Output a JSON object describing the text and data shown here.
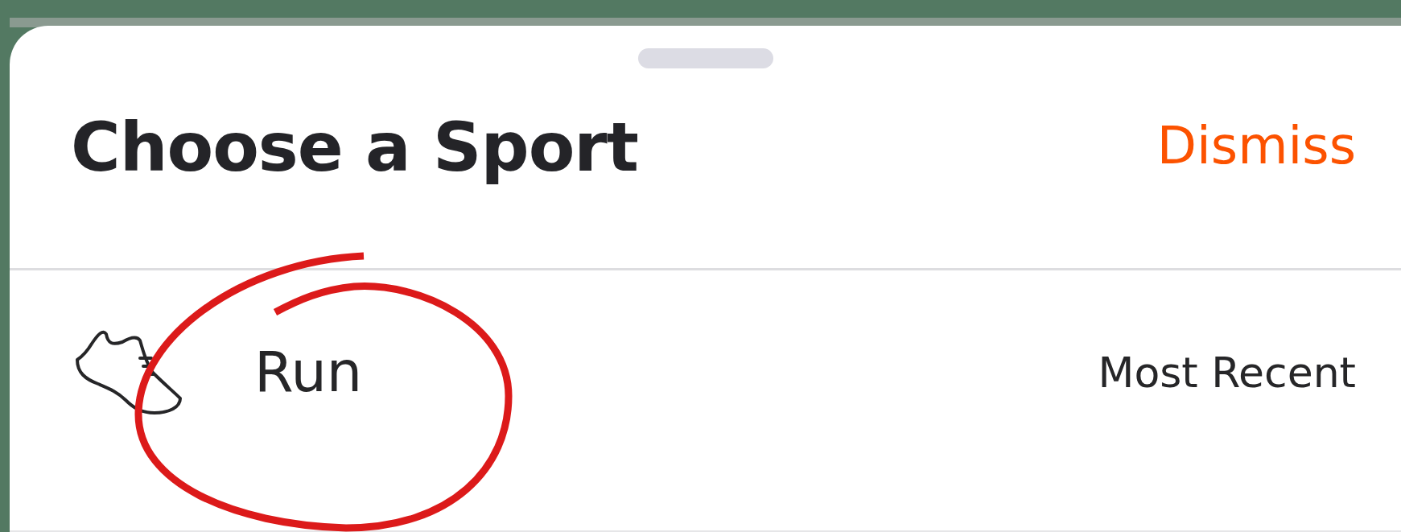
{
  "sheet": {
    "title": "Choose a Sport",
    "dismiss": "Dismiss"
  },
  "sports": [
    {
      "label": "Run",
      "detail": "Most Recent"
    }
  ],
  "annotation": {
    "kind": "circle"
  }
}
